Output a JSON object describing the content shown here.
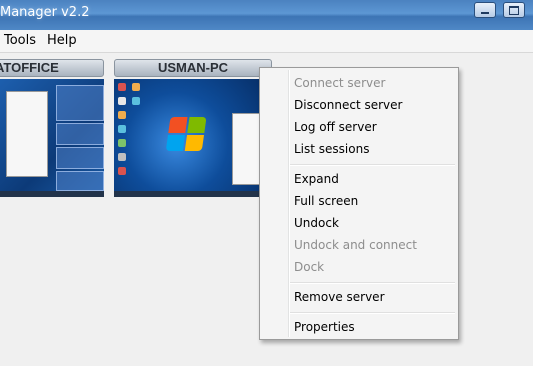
{
  "window": {
    "title": "Manager v2.2"
  },
  "menubar": {
    "items": [
      {
        "label": "Tools"
      },
      {
        "label": "Help"
      }
    ]
  },
  "servers": [
    {
      "name": "ATOFFICE"
    },
    {
      "name": "USMAN-PC"
    }
  ],
  "context_menu": {
    "items": [
      {
        "label": "Connect server",
        "enabled": false
      },
      {
        "label": "Disconnect server",
        "enabled": true
      },
      {
        "label": "Log off server",
        "enabled": true
      },
      {
        "label": "List sessions",
        "enabled": true
      },
      {
        "label": "Expand",
        "enabled": true
      },
      {
        "label": "Full screen",
        "enabled": true
      },
      {
        "label": "Undock",
        "enabled": true
      },
      {
        "label": "Undock and connect",
        "enabled": false
      },
      {
        "label": "Dock",
        "enabled": false
      },
      {
        "label": "Remove server",
        "enabled": true
      },
      {
        "label": "Properties",
        "enabled": true
      }
    ]
  },
  "colors": {
    "titlebar": "#4f88c6",
    "disabled_text": "#8d8d8d"
  }
}
